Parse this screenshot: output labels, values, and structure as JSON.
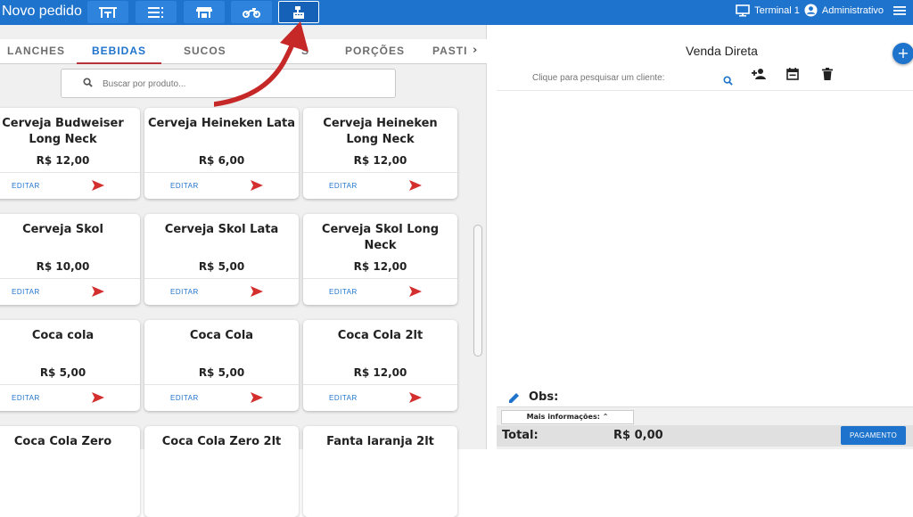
{
  "header": {
    "title": "Novo pedido",
    "nav_buttons": [
      {
        "icon": "tables-icon"
      },
      {
        "icon": "list-icon"
      },
      {
        "icon": "store-icon"
      },
      {
        "icon": "motorcycle-icon"
      },
      {
        "icon": "cash-register-icon",
        "active": true
      }
    ],
    "terminal": "Terminal 1",
    "user": "Administrativo"
  },
  "categories": {
    "tabs": [
      "LANCHES",
      "BEBIDAS",
      "SUCOS",
      "S",
      "PORÇÕES",
      "PASTI"
    ],
    "active": "BEBIDAS"
  },
  "search": {
    "placeholder": "Buscar por produto..."
  },
  "products": [
    {
      "name": "Cerveja Budweiser Long Neck",
      "price": "R$ 12,00"
    },
    {
      "name": "Cerveja Heineken Lata",
      "price": "R$ 6,00"
    },
    {
      "name": "Cerveja Heineken Long Neck",
      "price": "R$ 12,00"
    },
    {
      "name": "Cerveja Skol",
      "price": "R$ 10,00"
    },
    {
      "name": "Cerveja Skol Lata",
      "price": "R$ 5,00"
    },
    {
      "name": "Cerveja Skol Long Neck",
      "price": "R$ 12,00"
    },
    {
      "name": "Coca cola",
      "price": "R$ 5,00"
    },
    {
      "name": "Coca Cola",
      "price": "R$ 5,00"
    },
    {
      "name": "Coca Cola 2lt",
      "price": "R$ 12,00"
    },
    {
      "name": "Coca Cola Zero",
      "price": ""
    },
    {
      "name": "Coca Cola Zero 2lt",
      "price": ""
    },
    {
      "name": "Fanta laranja 2lt",
      "price": ""
    }
  ],
  "card_actions": {
    "edit_label": "EDITAR"
  },
  "sale": {
    "title": "Venda Direta",
    "client_placeholder": "Clique para pesquisar um cliente:",
    "obs_label": "Obs:",
    "more_info_label": "Mais informações:",
    "total_label": "Total:",
    "total_value": "R$ 0,00",
    "payment_label": "PAGAMENTO"
  },
  "colors": {
    "primary": "#1e73cc",
    "accent_red": "#d32f2f",
    "tab_underline": "#b8323a"
  }
}
